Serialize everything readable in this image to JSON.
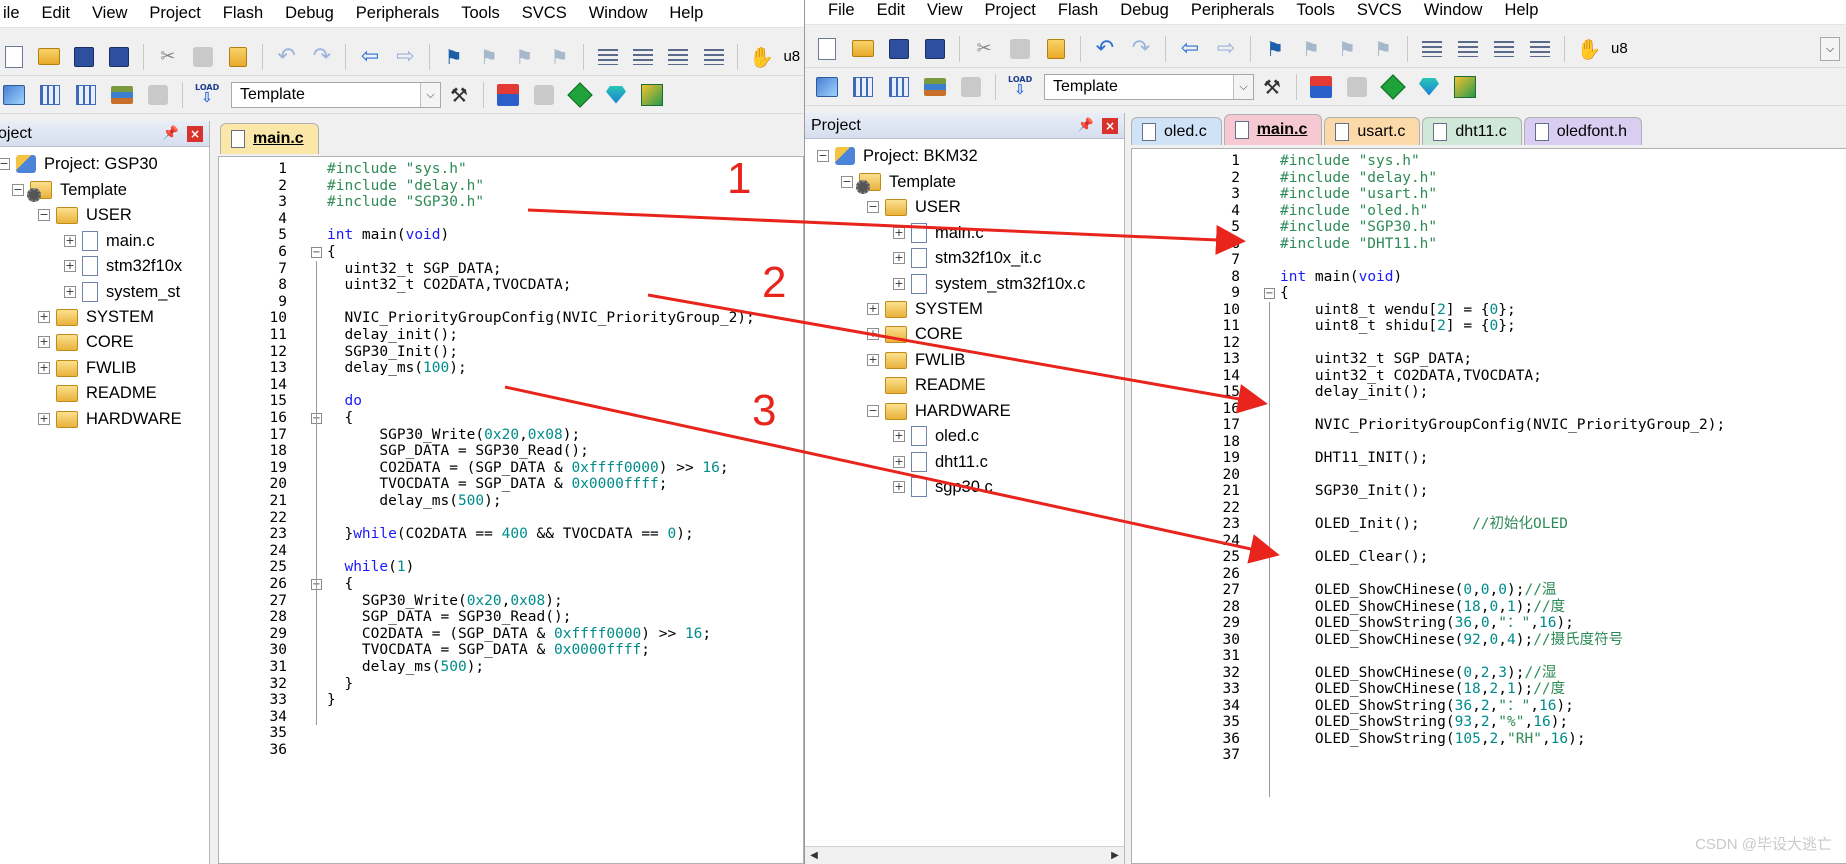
{
  "menu": [
    "File",
    "Edit",
    "View",
    "Project",
    "Flash",
    "Debug",
    "Peripherals",
    "Tools",
    "SVCS",
    "Window",
    "Help"
  ],
  "left": {
    "menu_first": "ile",
    "toolbar_target_text": "u8",
    "target_name": "Template",
    "panel_title": "oject",
    "tab": "main.c",
    "tree": [
      {
        "label": "Project: GSP30"
      },
      {
        "label": "Template"
      },
      {
        "label": "USER"
      },
      {
        "label": "main.c"
      },
      {
        "label": "stm32f10x"
      },
      {
        "label": "system_st"
      },
      {
        "label": "SYSTEM"
      },
      {
        "label": "CORE"
      },
      {
        "label": "FWLIB"
      },
      {
        "label": "README"
      },
      {
        "label": "HARDWARE"
      }
    ],
    "code": [
      [
        [
          "#include \"sys.h\"",
          "green"
        ]
      ],
      [
        [
          "#include \"delay.h\"",
          "green"
        ]
      ],
      [
        [
          "#include \"SGP30.h\"",
          "green"
        ]
      ],
      [],
      [
        [
          "int",
          "blue"
        ],
        [
          " main(",
          "black"
        ],
        [
          "void",
          "blue"
        ],
        [
          ")",
          "black"
        ]
      ],
      [
        [
          "{",
          "black"
        ]
      ],
      [
        [
          "  uint32_t SGP_DATA;",
          "black"
        ]
      ],
      [
        [
          "  uint32_t CO2DATA,TVOCDATA;",
          "black"
        ]
      ],
      [],
      [
        [
          "  NVIC_PriorityGroupConfig(NVIC_PriorityGroup_2);",
          "black"
        ]
      ],
      [
        [
          "  delay_init();",
          "black"
        ]
      ],
      [
        [
          "  SGP30_Init();",
          "black"
        ]
      ],
      [
        [
          "  delay_ms(",
          "black"
        ],
        [
          "100",
          "teal"
        ],
        [
          ");",
          "black"
        ]
      ],
      [],
      [
        [
          "  ",
          "black"
        ],
        [
          "do",
          "blue"
        ]
      ],
      [
        [
          "  {",
          "black"
        ]
      ],
      [
        [
          "      SGP30_Write(",
          "black"
        ],
        [
          "0x20",
          "teal"
        ],
        [
          ",",
          "black"
        ],
        [
          "0x08",
          "teal"
        ],
        [
          ");",
          "black"
        ]
      ],
      [
        [
          "      SGP_DATA = SGP30_Read();",
          "black"
        ]
      ],
      [
        [
          "      CO2DATA = (SGP_DATA & ",
          "black"
        ],
        [
          "0xffff0000",
          "teal"
        ],
        [
          ") >> ",
          "black"
        ],
        [
          "16",
          "teal"
        ],
        [
          ";",
          "black"
        ]
      ],
      [
        [
          "      TVOCDATA = SGP_DATA & ",
          "black"
        ],
        [
          "0x0000ffff",
          "teal"
        ],
        [
          ";",
          "black"
        ]
      ],
      [
        [
          "      delay_ms(",
          "black"
        ],
        [
          "500",
          "teal"
        ],
        [
          ");",
          "black"
        ]
      ],
      [],
      [
        [
          "  }",
          "black"
        ],
        [
          "while",
          "blue"
        ],
        [
          "(CO2DATA == ",
          "black"
        ],
        [
          "400",
          "teal"
        ],
        [
          " && TVOCDATA == ",
          "black"
        ],
        [
          "0",
          "teal"
        ],
        [
          ");",
          "black"
        ]
      ],
      [],
      [
        [
          "  ",
          "black"
        ],
        [
          "while",
          "blue"
        ],
        [
          "(",
          "black"
        ],
        [
          "1",
          "teal"
        ],
        [
          ")",
          "black"
        ]
      ],
      [
        [
          "  {",
          "black"
        ]
      ],
      [
        [
          "    SGP30_Write(",
          "black"
        ],
        [
          "0x20",
          "teal"
        ],
        [
          ",",
          "black"
        ],
        [
          "0x08",
          "teal"
        ],
        [
          ");",
          "black"
        ]
      ],
      [
        [
          "    SGP_DATA = SGP30_Read();",
          "black"
        ]
      ],
      [
        [
          "    CO2DATA = (SGP_DATA & ",
          "black"
        ],
        [
          "0xffff0000",
          "teal"
        ],
        [
          ") >> ",
          "black"
        ],
        [
          "16",
          "teal"
        ],
        [
          ";",
          "black"
        ]
      ],
      [
        [
          "    TVOCDATA = SGP_DATA & ",
          "black"
        ],
        [
          "0x0000ffff",
          "teal"
        ],
        [
          ";",
          "black"
        ]
      ],
      [
        [
          "    delay_ms(",
          "black"
        ],
        [
          "500",
          "teal"
        ],
        [
          ");",
          "black"
        ]
      ],
      [
        [
          "  }",
          "black"
        ]
      ],
      [
        [
          "}",
          "black"
        ]
      ],
      [],
      [],
      []
    ]
  },
  "right": {
    "toolbar_target_text": "u8",
    "target_name": "Template",
    "panel_title": "Project",
    "tabs": [
      {
        "label": "oled.c",
        "color": "#cfe3f7",
        "active": false
      },
      {
        "label": "main.c",
        "color": "#f6c8d2",
        "active": true
      },
      {
        "label": "usart.c",
        "color": "#fcd9a8",
        "active": false
      },
      {
        "label": "dht11.c",
        "color": "#cfe8d8",
        "active": false
      },
      {
        "label": "oledfont.h",
        "color": "#d9cdf2",
        "active": false
      }
    ],
    "tree": [
      {
        "label": "Project: BKM32"
      },
      {
        "label": "Template"
      },
      {
        "label": "USER"
      },
      {
        "label": "main.c"
      },
      {
        "label": "stm32f10x_it.c"
      },
      {
        "label": "system_stm32f10x.c"
      },
      {
        "label": "SYSTEM"
      },
      {
        "label": "CORE"
      },
      {
        "label": "FWLIB"
      },
      {
        "label": "README"
      },
      {
        "label": "HARDWARE"
      },
      {
        "label": "oled.c"
      },
      {
        "label": "dht11.c"
      },
      {
        "label": "sgp30.c"
      }
    ],
    "code": [
      [
        [
          "#include \"sys.h\"",
          "green"
        ]
      ],
      [
        [
          "#include \"delay.h\"",
          "green"
        ]
      ],
      [
        [
          "#include \"usart.h\"",
          "green"
        ]
      ],
      [
        [
          "#include \"oled.h\"",
          "green"
        ]
      ],
      [
        [
          "#include \"SGP30.h\"",
          "green"
        ]
      ],
      [
        [
          "#include \"DHT11.h\"",
          "green"
        ]
      ],
      [],
      [
        [
          "int",
          "blue"
        ],
        [
          " main(",
          "black"
        ],
        [
          "void",
          "blue"
        ],
        [
          ")",
          "black"
        ]
      ],
      [
        [
          "{",
          "black"
        ]
      ],
      [
        [
          "    uint8_t wendu[",
          "black"
        ],
        [
          "2",
          "teal"
        ],
        [
          "] = {",
          "black"
        ],
        [
          "0",
          "teal"
        ],
        [
          "};",
          "black"
        ]
      ],
      [
        [
          "    uint8_t shidu[",
          "black"
        ],
        [
          "2",
          "teal"
        ],
        [
          "] = {",
          "black"
        ],
        [
          "0",
          "teal"
        ],
        [
          "};",
          "black"
        ]
      ],
      [],
      [
        [
          "    uint32_t SGP_DATA;",
          "black"
        ]
      ],
      [
        [
          "    uint32_t CO2DATA,TVOCDATA;",
          "black"
        ]
      ],
      [
        [
          "    delay_init();",
          "black"
        ]
      ],
      [],
      [
        [
          "    NVIC_PriorityGroupConfig(NVIC_PriorityGroup_2);",
          "black"
        ]
      ],
      [],
      [
        [
          "    DHT11_INIT();",
          "black"
        ]
      ],
      [],
      [
        [
          "    SGP30_Init();",
          "black"
        ]
      ],
      [],
      [
        [
          "    OLED_Init();      ",
          "black"
        ],
        [
          "//初始化OLED",
          "green"
        ]
      ],
      [],
      [
        [
          "    OLED_Clear();",
          "black"
        ]
      ],
      [],
      [
        [
          "    OLED_ShowCHinese(",
          "black"
        ],
        [
          "0",
          "teal"
        ],
        [
          ",",
          "black"
        ],
        [
          "0",
          "teal"
        ],
        [
          ",",
          "black"
        ],
        [
          "0",
          "teal"
        ],
        [
          ");",
          "black"
        ],
        [
          "//温",
          "green"
        ]
      ],
      [
        [
          "    OLED_ShowCHinese(",
          "black"
        ],
        [
          "18",
          "teal"
        ],
        [
          ",",
          "black"
        ],
        [
          "0",
          "teal"
        ],
        [
          ",",
          "black"
        ],
        [
          "1",
          "teal"
        ],
        [
          ");",
          "black"
        ],
        [
          "//度",
          "green"
        ]
      ],
      [
        [
          "    OLED_ShowString(",
          "black"
        ],
        [
          "36",
          "teal"
        ],
        [
          ",",
          "black"
        ],
        [
          "0",
          "teal"
        ],
        [
          ",",
          "black"
        ],
        [
          "\"：\"",
          "green"
        ],
        [
          ",",
          "black"
        ],
        [
          "16",
          "teal"
        ],
        [
          ");",
          "black"
        ]
      ],
      [
        [
          "    OLED_ShowCHinese(",
          "black"
        ],
        [
          "92",
          "teal"
        ],
        [
          ",",
          "black"
        ],
        [
          "0",
          "teal"
        ],
        [
          ",",
          "black"
        ],
        [
          "4",
          "teal"
        ],
        [
          ");",
          "black"
        ],
        [
          "//摄氏度符号",
          "green"
        ]
      ],
      [],
      [
        [
          "    OLED_ShowCHinese(",
          "black"
        ],
        [
          "0",
          "teal"
        ],
        [
          ",",
          "black"
        ],
        [
          "2",
          "teal"
        ],
        [
          ",",
          "black"
        ],
        [
          "3",
          "teal"
        ],
        [
          ");",
          "black"
        ],
        [
          "//湿",
          "green"
        ]
      ],
      [
        [
          "    OLED_ShowCHinese(",
          "black"
        ],
        [
          "18",
          "teal"
        ],
        [
          ",",
          "black"
        ],
        [
          "2",
          "teal"
        ],
        [
          ",",
          "black"
        ],
        [
          "1",
          "teal"
        ],
        [
          ");",
          "black"
        ],
        [
          "//度",
          "green"
        ]
      ],
      [
        [
          "    OLED_ShowString(",
          "black"
        ],
        [
          "36",
          "teal"
        ],
        [
          ",",
          "black"
        ],
        [
          "2",
          "teal"
        ],
        [
          ",",
          "black"
        ],
        [
          "\"：\"",
          "green"
        ],
        [
          ",",
          "black"
        ],
        [
          "16",
          "teal"
        ],
        [
          ");",
          "black"
        ]
      ],
      [
        [
          "    OLED_ShowString(",
          "black"
        ],
        [
          "93",
          "teal"
        ],
        [
          ",",
          "black"
        ],
        [
          "2",
          "teal"
        ],
        [
          ",",
          "black"
        ],
        [
          "\"%\"",
          "green"
        ],
        [
          ",",
          "black"
        ],
        [
          "16",
          "teal"
        ],
        [
          ");",
          "black"
        ]
      ],
      [
        [
          "    OLED_ShowString(",
          "black"
        ],
        [
          "105",
          "teal"
        ],
        [
          ",",
          "black"
        ],
        [
          "2",
          "teal"
        ],
        [
          ",",
          "black"
        ],
        [
          "\"RH\"",
          "green"
        ],
        [
          ",",
          "black"
        ],
        [
          "16",
          "teal"
        ],
        [
          ");",
          "black"
        ]
      ],
      []
    ]
  },
  "annotations": [
    "1",
    "2",
    "3"
  ],
  "watermark": "CSDN @毕设大逃亡",
  "colors": {
    "arrow": "#e8241c",
    "code_green": "#2e8b57",
    "code_blue": "#1a1aff",
    "code_teal": "#008b8b"
  }
}
